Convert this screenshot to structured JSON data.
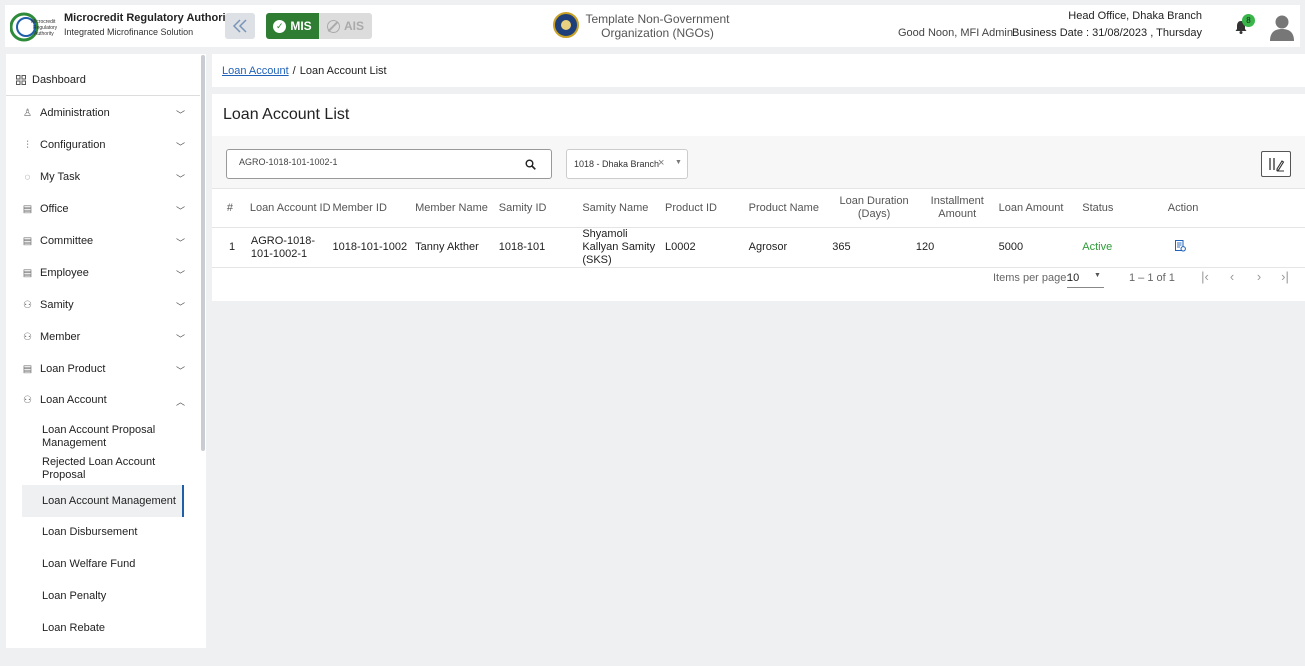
{
  "header": {
    "brand_title": "Microcredit Regulatory Authority",
    "brand_subtitle": "Integrated Microfinance Solution",
    "logo_text": [
      "Microcredit",
      "Regulatory",
      "Authority"
    ],
    "mode_mis": "MIS",
    "mode_ais": "AIS",
    "org_name": "Template Non-Government Organization (NGOs)",
    "greeting": "Good Noon, MFI Admin",
    "branch": "Head Office, Dhaka Branch",
    "business_date": "Business Date : 31/08/2023 , Thursday",
    "notification_count": "8"
  },
  "sidebar": {
    "dashboard": "Dashboard",
    "items": [
      {
        "label": "Administration",
        "icon": "admin-icon"
      },
      {
        "label": "Configuration",
        "icon": "config-icon"
      },
      {
        "label": "My Task",
        "icon": "task-icon"
      },
      {
        "label": "Office",
        "icon": "office-icon"
      },
      {
        "label": "Committee",
        "icon": "committee-icon"
      },
      {
        "label": "Employee",
        "icon": "employee-icon"
      },
      {
        "label": "Samity",
        "icon": "samity-icon"
      },
      {
        "label": "Member",
        "icon": "member-icon"
      },
      {
        "label": "Loan Product",
        "icon": "loan-product-icon"
      },
      {
        "label": "Loan Account",
        "icon": "loan-account-icon"
      }
    ],
    "sub_items": [
      {
        "label": "Loan Account Proposal Management"
      },
      {
        "label": "Rejected Loan Account Proposal"
      },
      {
        "label": "Loan Account Management"
      },
      {
        "label": "Loan Disbursement"
      },
      {
        "label": "Loan Welfare Fund"
      },
      {
        "label": "Loan Penalty"
      },
      {
        "label": "Loan Rebate"
      }
    ]
  },
  "breadcrumb": {
    "parent": "Loan Account",
    "separator": "/",
    "current": "Loan Account List"
  },
  "page": {
    "title": "Loan Account List",
    "search_value": "AGRO-1018-101-1002-1",
    "branch_filter": "1018 - Dhaka Branch"
  },
  "table": {
    "headers": [
      "#",
      "Loan Account ID",
      "Member ID",
      "Member Name",
      "Samity ID",
      "Samity Name",
      "Product ID",
      "Product Name",
      "Loan Duration (Days)",
      "Installment Amount",
      "Loan Amount",
      "Status",
      "Action"
    ],
    "rows": [
      {
        "index": "1",
        "loan_account_id": "AGRO-1018-101-1002-1",
        "member_id": "1018-101-1002",
        "member_name": "Tanny Akther",
        "samity_id": "1018-101",
        "samity_name": "Shyamoli Kallyan Samity (SKS)",
        "product_id": "L0002",
        "product_name": "Agrosor",
        "loan_duration": "365",
        "installment_amount": "120",
        "loan_amount": "5000",
        "status": "Active"
      }
    ]
  },
  "pager": {
    "items_per_page_label": "Items per page:",
    "page_size": "10",
    "range": "1 – 1 of 1"
  },
  "colors": {
    "mis_green": "#2e7d32",
    "link_blue": "#1f62b8",
    "status_active": "#2e9c36",
    "active_marker": "#1f5fa8"
  }
}
